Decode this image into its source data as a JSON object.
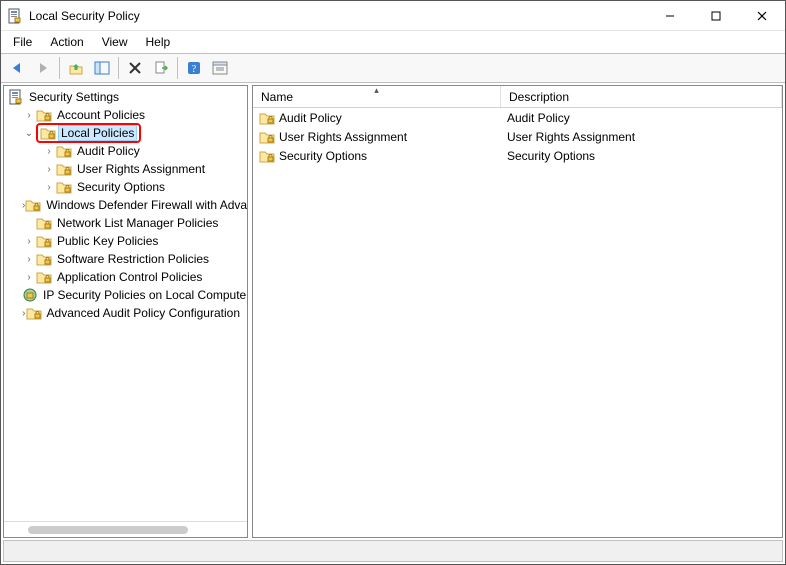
{
  "window": {
    "title": "Local Security Policy"
  },
  "menubar": [
    "File",
    "Action",
    "View",
    "Help"
  ],
  "tree": {
    "root": "Security Settings",
    "items": [
      {
        "label": "Account Policies",
        "expander": "›"
      },
      {
        "label": "Local Policies",
        "expander": "⌄",
        "selected": true,
        "highlighted": true,
        "children": [
          {
            "label": "Audit Policy",
            "expander": "›"
          },
          {
            "label": "User Rights Assignment",
            "expander": "›"
          },
          {
            "label": "Security Options",
            "expander": "›"
          }
        ]
      },
      {
        "label": "Windows Defender Firewall with Advanced Security",
        "expander": "›"
      },
      {
        "label": "Network List Manager Policies",
        "expander": ""
      },
      {
        "label": "Public Key Policies",
        "expander": "›"
      },
      {
        "label": "Software Restriction Policies",
        "expander": "›"
      },
      {
        "label": "Application Control Policies",
        "expander": "›"
      },
      {
        "label": "IP Security Policies on Local Computer",
        "expander": "",
        "icon": "ipsec"
      },
      {
        "label": "Advanced Audit Policy Configuration",
        "expander": "›"
      }
    ]
  },
  "list": {
    "columns": {
      "name": "Name",
      "desc": "Description"
    },
    "rows": [
      {
        "name": "Audit Policy",
        "desc": "Audit Policy"
      },
      {
        "name": "User Rights Assignment",
        "desc": "User Rights Assignment"
      },
      {
        "name": "Security Options",
        "desc": "Security Options"
      }
    ]
  }
}
